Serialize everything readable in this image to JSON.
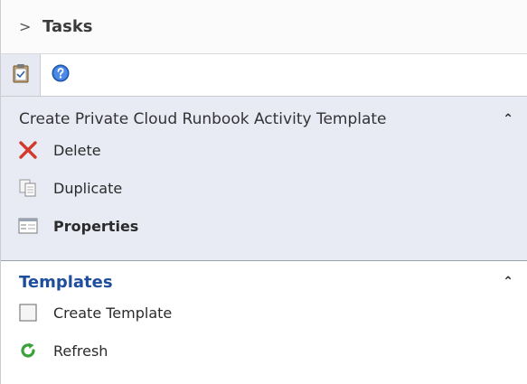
{
  "header": {
    "chevron": ">",
    "title": "Tasks"
  },
  "tabs": [
    {
      "icon": "clipboard-icon"
    },
    {
      "icon": "help-icon"
    }
  ],
  "section1": {
    "title": "Create Private Cloud Runbook Activity Template",
    "items": [
      {
        "label": "Delete",
        "icon": "delete-icon"
      },
      {
        "label": "Duplicate",
        "icon": "duplicate-icon"
      },
      {
        "label": "Properties",
        "icon": "properties-icon"
      }
    ]
  },
  "section2": {
    "title": "Templates",
    "items": [
      {
        "label": "Create Template",
        "icon": "template-icon"
      },
      {
        "label": "Refresh",
        "icon": "refresh-icon"
      }
    ]
  },
  "colors": {
    "section_bg": "#e8ebf4",
    "link_blue": "#1f4e9d",
    "delete_red": "#d23a2c",
    "refresh_green": "#3aa23a"
  }
}
